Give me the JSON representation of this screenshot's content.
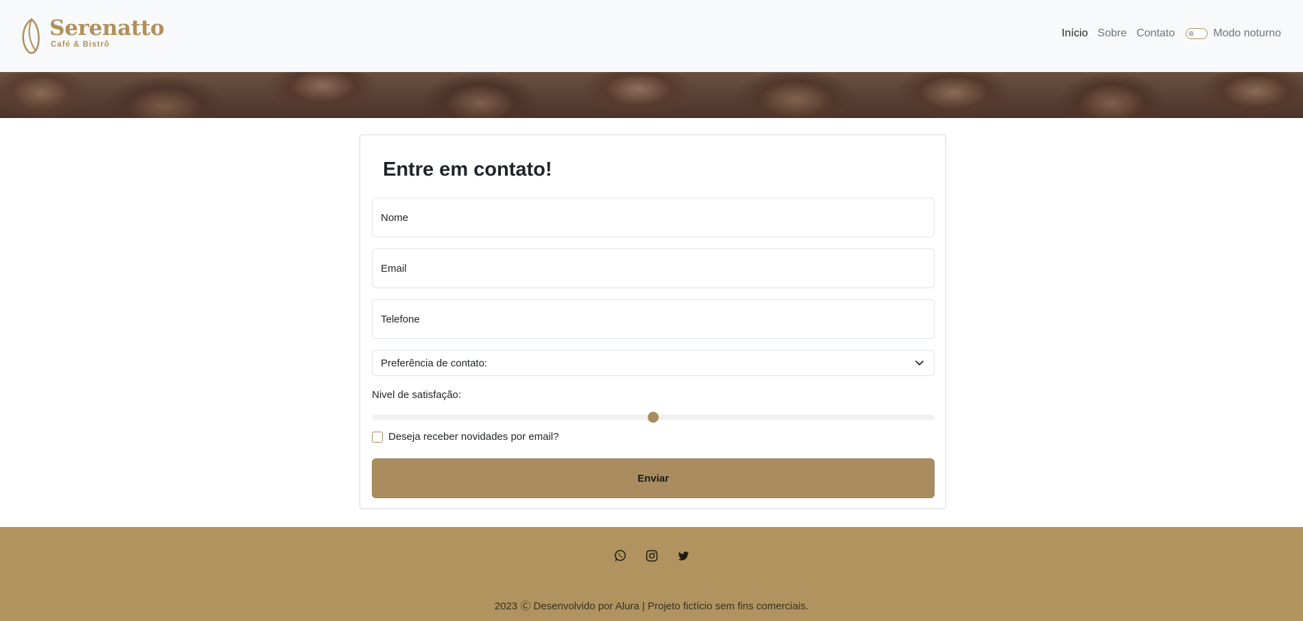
{
  "brand": {
    "name": "Serenatto",
    "tagline": "Café & Bistrô",
    "color": "#b0915a"
  },
  "nav": {
    "items": [
      {
        "label": "Início",
        "active": true
      },
      {
        "label": "Sobre",
        "active": false
      },
      {
        "label": "Contato",
        "active": false
      }
    ],
    "dark_mode_label": "Modo noturno",
    "dark_mode_on": false
  },
  "banner": {
    "icon": "coffee-beans-banner"
  },
  "form": {
    "title": "Entre em contato!",
    "fields": [
      {
        "placeholder": "Nome"
      },
      {
        "placeholder": "Email"
      },
      {
        "placeholder": "Telefone"
      }
    ],
    "select_label": "Preferência de contato:",
    "range_label": "Nivel de satisfação:",
    "range_value": 0.5,
    "checkbox_label": "Deseja receber novidades por email?",
    "checkbox_checked": false,
    "submit_label": "Enviar",
    "accent": "#a98d5f"
  },
  "footer": {
    "background": "#b0935f",
    "social": [
      "whatsapp-icon",
      "instagram-icon",
      "twitter-icon"
    ],
    "copyright": "2023 Ⓒ Desenvolvido por Alura | Projeto fictício sem fins comerciais."
  }
}
